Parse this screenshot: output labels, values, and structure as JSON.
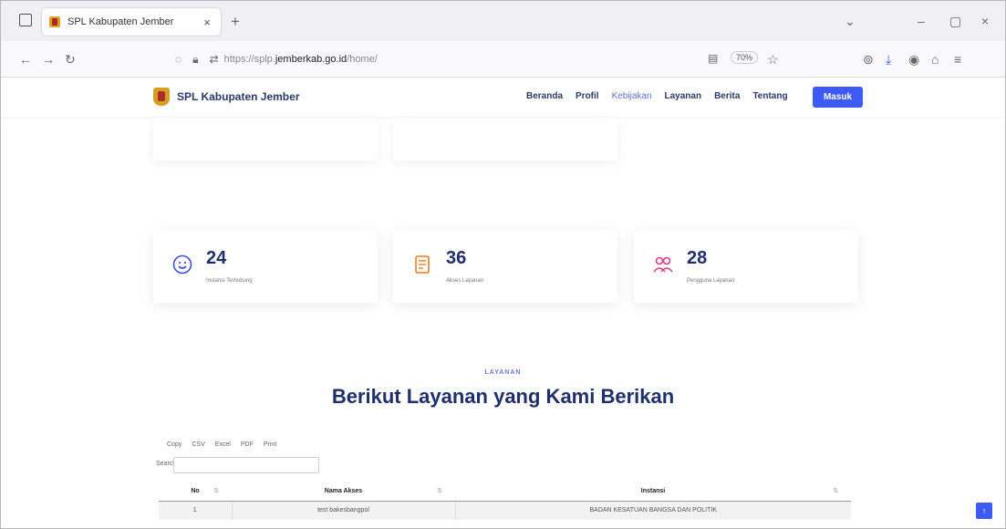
{
  "browser": {
    "tab_title": "SPL Kabupaten Jember",
    "tab_close": "×",
    "new_tab": "+",
    "url_prefix": "https://splp.",
    "url_host": "jemberkab.go.id",
    "url_suffix": "/home/",
    "zoom": "70%",
    "window_controls": [
      "–",
      "▢",
      "×"
    ]
  },
  "site": {
    "brand": "SPL Kabupaten Jember",
    "menu": [
      {
        "label": "Beranda",
        "active": false
      },
      {
        "label": "Profil",
        "active": false
      },
      {
        "label": "Kebijakan",
        "active": true
      },
      {
        "label": "Layanan",
        "active": false
      },
      {
        "label": "Berita",
        "active": false
      },
      {
        "label": "Tentang",
        "active": false
      }
    ],
    "login_label": "Masuk"
  },
  "stats": [
    {
      "number": "24",
      "label": "Instansi Terhubung",
      "icon": "smile-icon"
    },
    {
      "number": "36",
      "label": "Akses Layanan",
      "icon": "document-icon"
    },
    {
      "number": "28",
      "label": "Pengguna Layanan",
      "icon": "users-icon"
    }
  ],
  "section": {
    "tag": "LAYANAN",
    "title": "Berikut Layanan yang Kami Berikan"
  },
  "table_controls": {
    "buttons": [
      "Copy",
      "CSV",
      "Excel",
      "PDF",
      "Print"
    ],
    "search_label": "Search:"
  },
  "table": {
    "headers": [
      "No",
      "Nama Akses",
      "Instansi"
    ],
    "rows": [
      [
        "1",
        "test bakesbangpol",
        "BADAN KESATUAN BANGSA DAN POLITIK"
      ]
    ]
  },
  "colors": {
    "accent": "#3d5bf2",
    "heading": "#1f2f6c",
    "stat_icon_blue": "#3d4fd8",
    "stat_icon_orange": "#f07a24",
    "stat_icon_pink": "#e33b7a"
  }
}
